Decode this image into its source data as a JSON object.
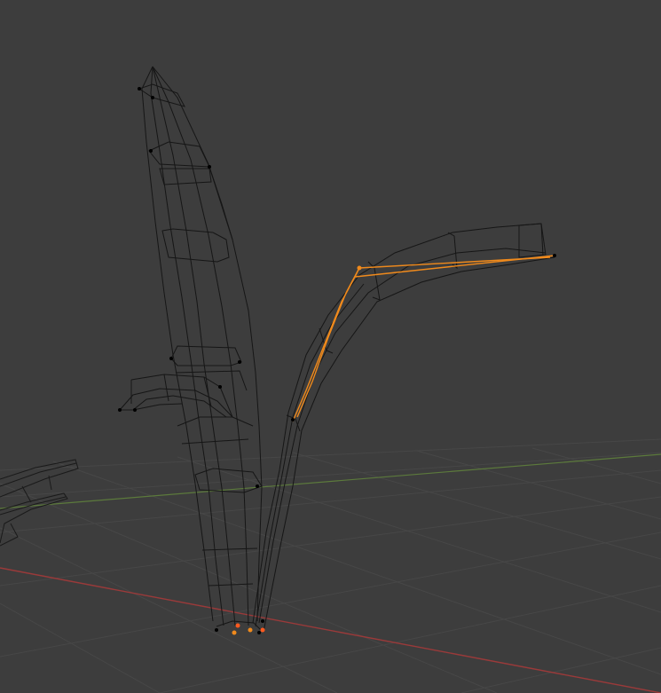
{
  "viewport": {
    "mode": "wireframe",
    "background_color": "#3d3d3d",
    "grid_line_color": "#474747",
    "x_axis_color": "#9a3a3a",
    "y_axis_color": "#5c7a3c",
    "wire_color": "#111111",
    "selection_color": "#f08a1c",
    "active_vertex_color": "#ff5a1f"
  }
}
